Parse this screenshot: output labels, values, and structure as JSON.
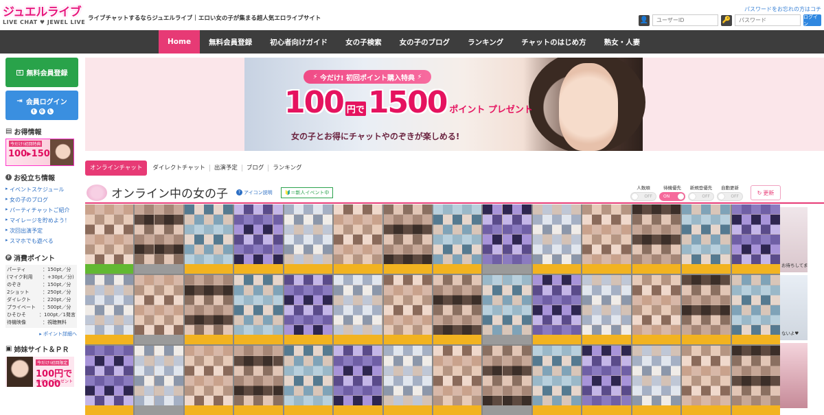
{
  "header": {
    "logo_main": "ジュエルライブ",
    "logo_sub": "LIVE CHAT ♥ JEWEL LIVE",
    "tagline": "ライブチャットするならジュエルライブ｜エロい女の子が集まる超人気エロライブサイト",
    "forgot_password": "パスワードをお忘れの方はコチ",
    "user_id_placeholder": "ユーザーID",
    "password_placeholder": "パスワード",
    "login_button": "ログイン"
  },
  "nav": {
    "items": [
      "Home",
      "無料会員登録",
      "初心者向けガイド",
      "女の子検索",
      "女の子のブログ",
      "ランキング",
      "チャットのはじめ方",
      "熟女・人妻"
    ],
    "active_index": 0
  },
  "sidebar": {
    "register_button": "無料会員登録",
    "login_button": "会員ログイン",
    "deals_heading": "お得情報",
    "deals_banner_tag": "今だけ!初回特典",
    "deals_banner_amount": "100▸1500",
    "useful_heading": "お役立ち情報",
    "useful_links": [
      "イベントスケジュール",
      "女の子のブログ",
      "パーティチャットご紹介",
      "マイレージを貯めよう！",
      "次回出演予定",
      "スマホでも遊べる"
    ],
    "points_heading": "消費ポイント",
    "points": [
      {
        "k": "パーティ",
        "v": "：150pt／分"
      },
      {
        "k": "(マイク利用",
        "v": "：+30pt／分)"
      },
      {
        "k": "のぞき",
        "v": "：150pt／分"
      },
      {
        "k": "2ショット",
        "v": "：250pt／分"
      },
      {
        "k": "ダイレクト",
        "v": "：220pt／分"
      },
      {
        "k": "プライベート",
        "v": "：500pt／分"
      },
      {
        "k": "ひそひそ",
        "v": "：100pt／1発言"
      },
      {
        "k": "待機映像",
        "v": "：視聴無料"
      }
    ],
    "points_more": "ポイント詳細へ",
    "pr_heading": "姉妹サイト＆ＰＲ",
    "pr_tag": "今だけ!初回限定",
    "pr_amount": "100円で1000",
    "pr_sub": "ポイントプレゼント"
  },
  "hero": {
    "tag": "今だけ! 初回ポイント購入特典",
    "amount_a": "100",
    "unit": "円で",
    "amount_b": "1500",
    "suffix": "ポイント プレゼント",
    "subline": "女の子とお得にチャットやのぞきが楽しめる!"
  },
  "tabs": [
    "オンラインチャット",
    "ダイレクトチャット",
    "出演予定",
    "ブログ",
    "ランキング"
  ],
  "section": {
    "title": "オンライン中の女の子",
    "help": "アイコン説明",
    "newbie": "＝新人イベント中"
  },
  "sorts": [
    {
      "label": "人数順",
      "state": "OFF",
      "on": false
    },
    {
      "label": "待機優先",
      "state": "ON",
      "on": true
    },
    {
      "label": "新規登優先",
      "state": "OFF",
      "on": false
    },
    {
      "label": "自動更新",
      "state": "OFF",
      "on": false
    }
  ],
  "refresh_label": "更新",
  "right_strip": [
    "お待ちしてません",
    "ないよ♥"
  ],
  "colors": {
    "accent": "#e73a75",
    "nav_bg": "#3d3d3d",
    "green": "#29a34a",
    "blue": "#3a8fe0",
    "bar_yellow": "#f2b320"
  }
}
